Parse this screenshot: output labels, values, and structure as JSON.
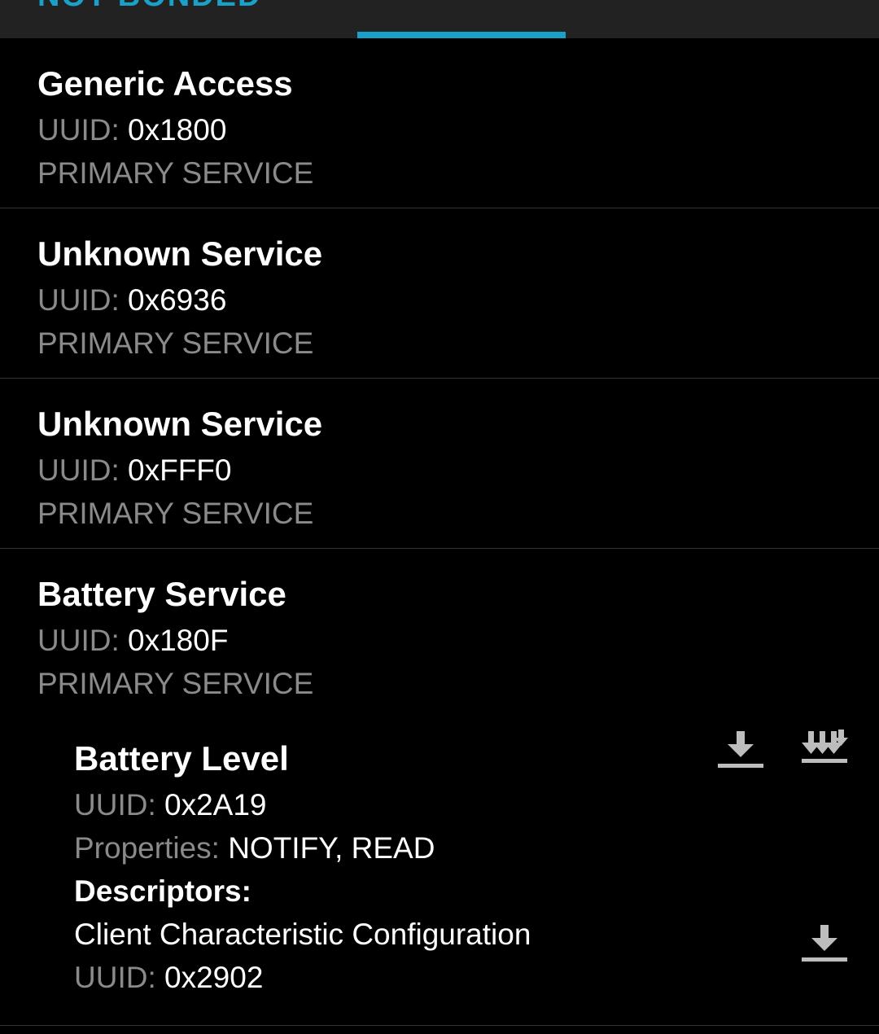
{
  "tab": {
    "label": "NOT BONDED",
    "accent_color": "#19a1c9"
  },
  "services": [
    {
      "name": "Generic Access",
      "uuid_label": "UUID:",
      "uuid": "0x1800",
      "type": "PRIMARY SERVICE"
    },
    {
      "name": "Unknown Service",
      "uuid_label": "UUID:",
      "uuid": "0x6936",
      "type": "PRIMARY SERVICE"
    },
    {
      "name": "Unknown Service",
      "uuid_label": "UUID:",
      "uuid": "0xFFF0",
      "type": "PRIMARY SERVICE"
    },
    {
      "name": "Battery Service",
      "uuid_label": "UUID:",
      "uuid": "0x180F",
      "type": "PRIMARY SERVICE"
    }
  ],
  "characteristic": {
    "name": "Battery Level",
    "uuid_label": "UUID:",
    "uuid": "0x2A19",
    "properties_label": "Properties:",
    "properties": "NOTIFY, READ",
    "descriptors_label": "Descriptors:",
    "read_icon": "download-icon",
    "notify_icon": "multi-download-icon",
    "descriptor": {
      "name": "Client Characteristic Configuration",
      "uuid_label": "UUID:",
      "uuid": "0x2902",
      "read_icon": "download-icon"
    }
  },
  "colors": {
    "background": "#000000",
    "muted_text": "#8a8a8a",
    "icon": "#bdbdbd",
    "divider": "#333333"
  }
}
